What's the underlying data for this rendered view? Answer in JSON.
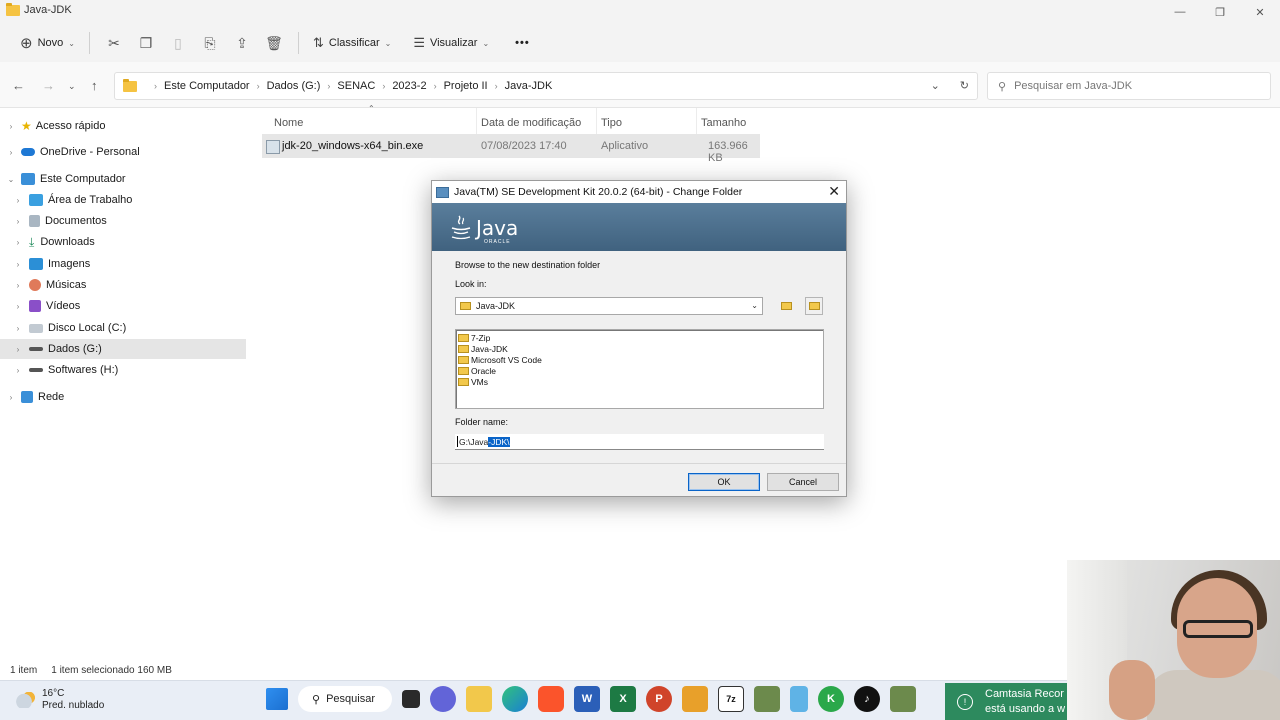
{
  "window": {
    "title": "Java-JDK",
    "controls": [
      "—",
      "❐",
      "✕"
    ]
  },
  "toolbar": {
    "new_label": "Novo",
    "sort_label": "Classificar",
    "view_label": "Visualizar",
    "more_label": "•••"
  },
  "address": {
    "breadcrumbs": [
      "Este Computador",
      "Dados (G:)",
      "SENAC",
      "2023-2",
      "Projeto II",
      "Java-JDK"
    ],
    "search_placeholder": "Pesquisar em Java-JDK"
  },
  "sidebar": {
    "items": [
      {
        "label": "Acesso rápido"
      },
      {
        "label": "OneDrive - Personal"
      },
      {
        "label": "Este Computador"
      },
      {
        "label": "Área de Trabalho"
      },
      {
        "label": "Documentos"
      },
      {
        "label": "Downloads"
      },
      {
        "label": "Imagens"
      },
      {
        "label": "Músicas"
      },
      {
        "label": "Vídeos"
      },
      {
        "label": "Disco Local (C:)"
      },
      {
        "label": "Dados (G:)"
      },
      {
        "label": "Softwares (H:)"
      },
      {
        "label": "Rede"
      }
    ],
    "selected": "Dados (G:)"
  },
  "filelist": {
    "columns": [
      "Nome",
      "Data de modificação",
      "Tipo",
      "Tamanho"
    ],
    "rows": [
      {
        "name": "jdk-20_windows-x64_bin.exe",
        "modified": "07/08/2023 17:40",
        "type": "Aplicativo",
        "size": "163.966 KB"
      }
    ]
  },
  "status": {
    "count": "1 item",
    "selection": "1 item selecionado  160 MB"
  },
  "dialog": {
    "title": "Java(TM) SE Development Kit 20.0.2 (64-bit) - Change Folder",
    "logo_word": "Java",
    "logo_sub": "ORACLE",
    "instruction": "Browse to the new destination folder",
    "look_in_label": "Look in:",
    "look_in_value": "Java-JDK",
    "folders": [
      "7-Zip",
      "Java-JDK",
      "Microsoft VS Code",
      "Oracle",
      "VMs"
    ],
    "folder_name_label": "Folder name:",
    "folder_name_prefix": "G:\\Java",
    "folder_name_selected": "-JDK\\",
    "ok_label": "OK",
    "cancel_label": "Cancel"
  },
  "taskbar": {
    "temperature": "16°C",
    "weather": "Pred. nublado",
    "search_label": "Pesquisar",
    "toast_line1": "Camtasia Recor",
    "toast_line2": "está usando a w"
  },
  "colors": {
    "accent": "#0a64c8",
    "java_banner": "#4b6e8c",
    "toast": "#2d8a5e"
  }
}
